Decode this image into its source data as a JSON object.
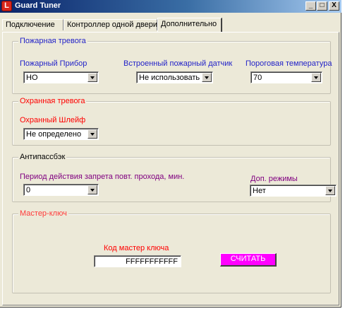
{
  "window": {
    "title": "Guard Tuner",
    "icon_letter": "L",
    "controls": {
      "minimize": "_",
      "maximize": "□",
      "close": "X"
    }
  },
  "tabs": [
    {
      "label": "Подключение",
      "active": false
    },
    {
      "label": "Контроллер одной двери",
      "active": false
    },
    {
      "label": "Дополнительно",
      "active": true
    }
  ],
  "fire": {
    "title": "Пожарная тревога",
    "device_label": "Пожарный Прибор",
    "device_value": "НО",
    "sensor_label": "Встроенный пожарный датчик",
    "sensor_value": "Не использовать",
    "threshold_label": "Пороговая температура",
    "threshold_value": "70"
  },
  "security": {
    "title": "Охранная тревога",
    "loop_label": "Охранный Шлейф",
    "loop_value": "Не определено"
  },
  "antipassback": {
    "title": "Антипассбэк",
    "period_label": "Период действия запрета повт. прохода, мин.",
    "period_value": "0",
    "modes_label": "Доп. режимы",
    "modes_value": "Нет"
  },
  "master": {
    "title": "Мастер-ключ",
    "code_label": "Код мастер ключа",
    "code_value": "FFFFFFFFFFF",
    "read_button": "СЧИТАТЬ"
  },
  "colors": {
    "blue_label": "#2323c8",
    "red_label": "#ff0000",
    "purple_label": "#800080",
    "read_button_bg": "#ff00ff",
    "panel_bg": "#ece9d8"
  }
}
